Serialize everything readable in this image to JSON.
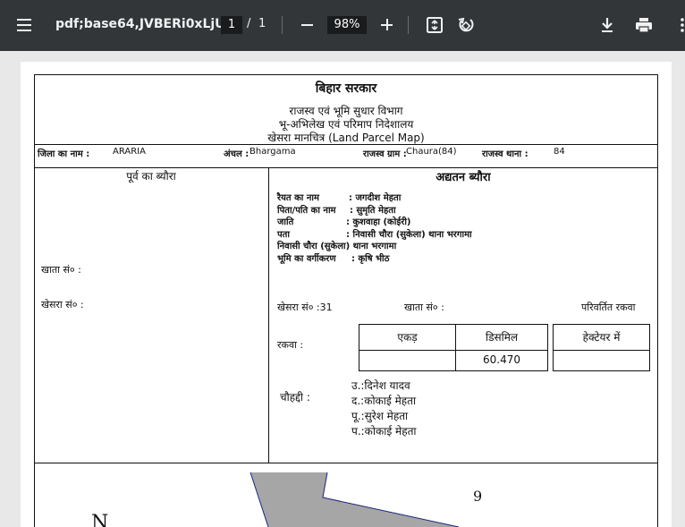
{
  "toolbar": {
    "title": "pdf;base64,JVBERi0xLjU...",
    "page_current": "1",
    "page_separator": "/",
    "page_total": "1",
    "zoom": "98%",
    "icons": [
      "menu-icon",
      "zoom-out-icon",
      "zoom-in-icon",
      "fit-page-icon",
      "rotate-icon",
      "download-icon",
      "print-icon",
      "more-icon"
    ],
    "colors": {
      "background": "#323639",
      "field_bg": "#191b1c",
      "text": "#f1f1f1"
    }
  },
  "document": {
    "header": {
      "government": "बिहार सरकार",
      "department": "राजस्व एवं भूमि सुधार विभाग",
      "directorate": "भू-अभिलेख एवं परिमाप निदेशालय",
      "map_title": "खेसरा मानचित्र (Land Parcel Map)"
    },
    "info_row": {
      "district_label": "जिला का नाम :",
      "district_value": "ARARIA",
      "anchal_label": "अंचल :",
      "anchal_value": "Bhargama",
      "village_label": "राजस्व ग्राम :",
      "village_value": "Chaura(84)",
      "thana_label": "राजस्व थाना :",
      "thana_value": "84"
    },
    "previous": {
      "heading": "पूर्व का ब्यौरा",
      "khata_label": "खाता सं० :",
      "khesra_label": "खेसरा सं० :"
    },
    "current": {
      "heading": "अद्यतन ब्यौरा",
      "raiyat_label": "रैयत का नाम",
      "raiyat_value": ": जगदीश मेहता",
      "father_label": "पिता/पति का नाम",
      "father_value": ": सुमृति मेहता",
      "caste_label": "जाति",
      "caste_value": ": कुशवाहा (कोईरी)",
      "address_label": "पता",
      "address_value": ": निवासी चौरा (सुकेला) थाना भरगामा",
      "address_line2": "निवासी चौरा (सुकेला) थाना भरगामा",
      "land_class_label": "भूमि का वर्गीकरण",
      "land_class_value": ": कृषि भीठ",
      "khesra_label": "खेसरा सं० :31",
      "khata_label": "खाता सं० :",
      "changed_area_label": "परिवर्तित रकवा",
      "area_label": "रकवा :",
      "area_table": {
        "headers": [
          "एकड़",
          "डिसमिल",
          "हेक्टेयर में"
        ],
        "values": [
          "",
          "60.470",
          ""
        ]
      },
      "boundary_label": "चौहद्दी :",
      "boundaries": [
        "उ.:दिनेश यादव",
        "द.:कोकाई मेहता",
        "पू.:सुरेश मेहता",
        "प.:कोकाई मेहता"
      ]
    },
    "map": {
      "plot_number": "9",
      "north_letter": "N",
      "plot_fill": "#a6a6a6",
      "boundary_color": "#1a237e"
    }
  }
}
